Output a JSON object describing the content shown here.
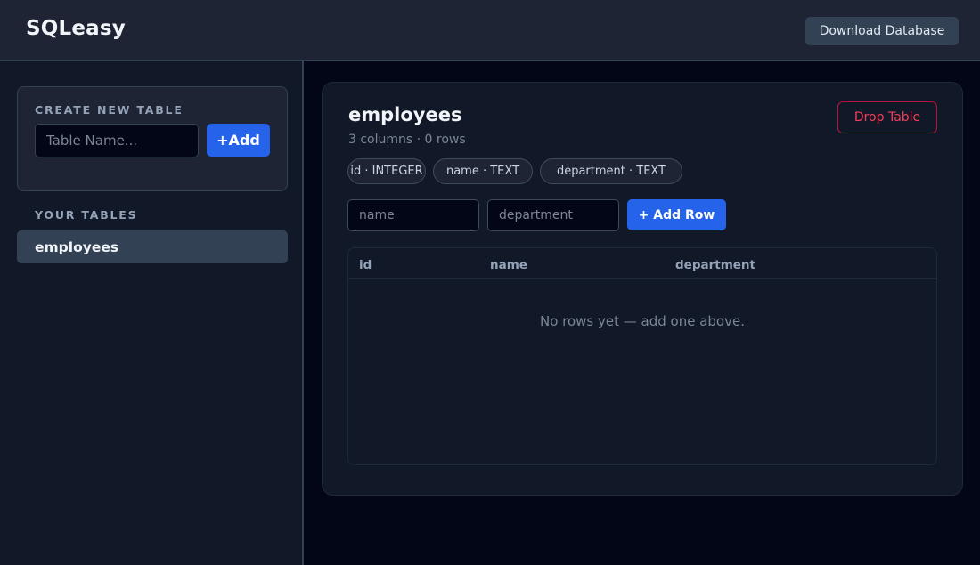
{
  "app": {
    "brand": "SQLeasy",
    "download_label": "Download Database"
  },
  "sidebar": {
    "create_label": "CREATE NEW TABLE",
    "table_name_placeholder": "Table Name...",
    "table_name_value": "",
    "add_label": "+Add",
    "your_tables_label": "YOUR TABLES",
    "tables": [
      {
        "name": "employees",
        "selected": true
      }
    ]
  },
  "main": {
    "table_name": "employees",
    "meta": "3 columns · 0 rows",
    "drop_label": "Drop Table",
    "columns": [
      {
        "chip": "id · INTEGER"
      },
      {
        "chip": "name · TEXT"
      },
      {
        "chip": "department · TEXT"
      }
    ],
    "new_row": {
      "name_placeholder": "name",
      "department_placeholder": "department",
      "add_row_label": "+ Add Row"
    },
    "table": {
      "headers": [
        "id",
        "name",
        "department"
      ],
      "rows": [],
      "empty_message": "No rows yet — add one above."
    }
  },
  "colors": {
    "accent": "#2563eb",
    "danger": "#f43f5e",
    "background": "#020617",
    "panel": "#111827"
  }
}
